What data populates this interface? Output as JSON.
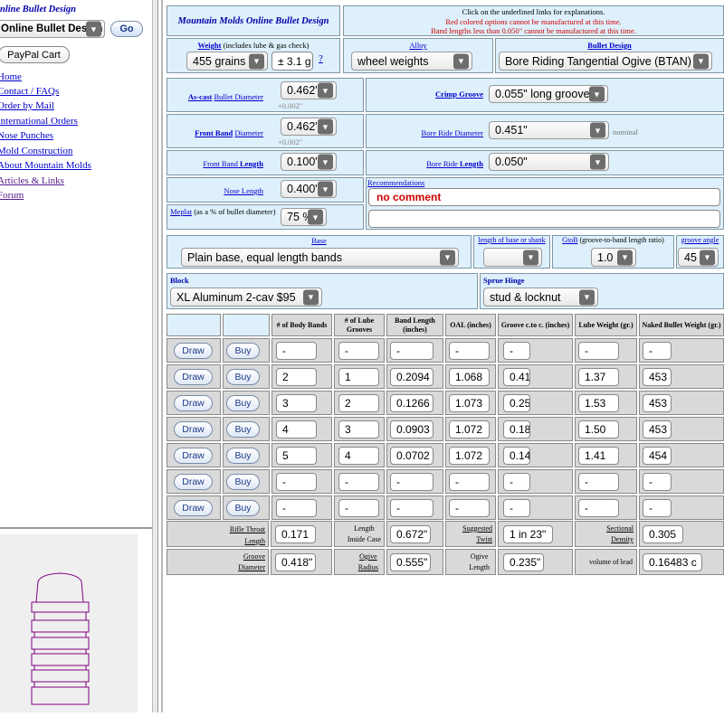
{
  "nav": {
    "title": "nline Bullet Design",
    "select_value": "Online Bullet Design",
    "go": "Go",
    "cart": "PayPal Cart",
    "links": [
      "Home",
      "Contact / FAQs",
      "Order by Mail",
      "International Orders",
      "Nose Punches",
      "Mold Construction",
      "About Mountain Molds",
      "Articles & Links",
      "Forum"
    ]
  },
  "header": {
    "title": "Mountain Molds Online Bullet Design",
    "info1": "Click on the underlined links for explanations.",
    "info2": "Red colored options cannot be manufactured at this time.",
    "info3": "Band lengths less than 0.050\" cannot be manufactured at this time."
  },
  "weight": {
    "label": "Weight",
    "note": "(includes lube & gas check)",
    "value": "455 grains",
    "tol": "± 3.1 g",
    "help": "?"
  },
  "alloy": {
    "label": "Alloy",
    "value": "wheel weights"
  },
  "design": {
    "label": "Bullet Design",
    "value": "Bore Riding Tangential Ogive (BTAN)"
  },
  "ascast": {
    "label_link": "As-cast",
    "label_rest": "Bullet Diameter",
    "value": "0.462\"",
    "tol": "+0.002\""
  },
  "crimp": {
    "label": "Crimp Groove",
    "value": "0.055\" long groove"
  },
  "frontband": {
    "label_link": "Front Band",
    "label_rest": "Diameter",
    "value": "0.462\"",
    "tol": "+0.002\""
  },
  "boreride": {
    "label": "Bore Ride Diameter",
    "value": "0.451\"",
    "note": "nominal"
  },
  "fbl": {
    "label_a": "Front Band",
    "label_b": "Length",
    "value": "0.100\""
  },
  "brl": {
    "label_a": "Bore Ride",
    "label_b": "Length",
    "value": "0.050\""
  },
  "nose": {
    "label": "Nose Length",
    "value": "0.400\""
  },
  "meplat": {
    "label_link": "Meplat",
    "label_rest": "(as a % of bullet diameter)",
    "value": "75 %"
  },
  "recs": {
    "label": "Recommendations",
    "text": "no comment"
  },
  "base": {
    "label": "Base",
    "value": "Plain base, equal length bands",
    "len_label": "length of base or shank",
    "gtob_label": "GtoB",
    "gtob_rest": "(groove-to-band length ratio)",
    "gtob": "1.0",
    "angle_label": "groove angle",
    "angle": "45"
  },
  "block": {
    "label": "Block",
    "value": "XL Aluminum 2-cav $95"
  },
  "sprue": {
    "label": "Sprue Hinge",
    "value": "stud & locknut"
  },
  "table": {
    "headers": [
      "# of Body Bands",
      "# of Lube Grooves",
      "Band Length (inches)",
      "OAL (inches)",
      "Groove c.to c. (inches)",
      "Lube Weight (gr.)",
      "Naked Bullet Weight (gr.)"
    ],
    "draw": "Draw",
    "buy": "Buy",
    "rows": [
      [
        "-",
        "-",
        "-",
        "-",
        "-",
        "-",
        "-"
      ],
      [
        "2",
        "1",
        "0.2094",
        "1.068",
        "0.41",
        "1.37",
        "453"
      ],
      [
        "3",
        "2",
        "0.1266",
        "1.073",
        "0.25",
        "1.53",
        "453"
      ],
      [
        "4",
        "3",
        "0.0903",
        "1.072",
        "0.18",
        "1.50",
        "453"
      ],
      [
        "5",
        "4",
        "0.0702",
        "1.072",
        "0.14",
        "1.41",
        "454"
      ],
      [
        "-",
        "-",
        "-",
        "-",
        "-",
        "-",
        "-"
      ],
      [
        "-",
        "-",
        "-",
        "-",
        "-",
        "-",
        "-"
      ]
    ]
  },
  "foot": {
    "rtl_a": "Rifle Throat",
    "rtl_b": "Length",
    "rtl": "0.171",
    "lic_a": "Length",
    "lic_b": "Inside Case",
    "lic": "0.672\"",
    "st_a": "Suggested",
    "st_b": "Twist",
    "st": "1 in 23\"",
    "sd_a": "Sectional",
    "sd_b": "Density",
    "sd": "0.305",
    "gd_a": "Groove",
    "gd_b": "Diameter",
    "gd": "0.418\"",
    "or_a": "Ogive",
    "or_b": "Radius",
    "or": "0.555\"",
    "ol_a": "Ogive",
    "ol_b": "Length",
    "ol": "0.235\"",
    "vl": "volume of lead",
    "vlv": "0.16483 c"
  },
  "colors": {
    "panel": "#ddf0fb",
    "link": "#0000cc",
    "red": "#d00000",
    "drawing": "#800080"
  }
}
